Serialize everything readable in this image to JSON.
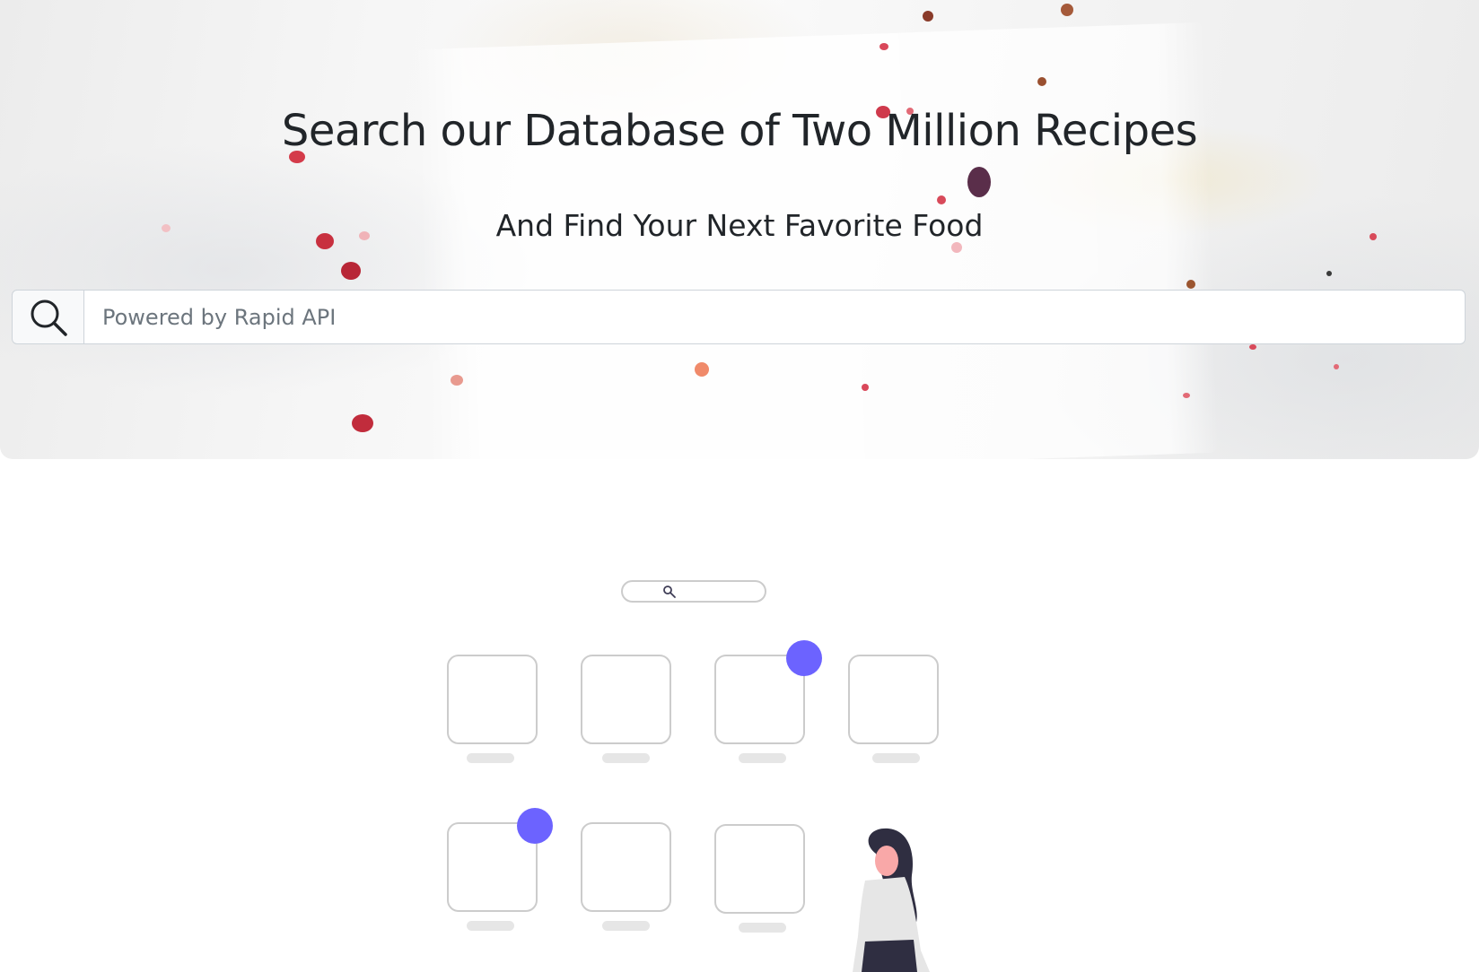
{
  "hero": {
    "title": "Search our Database of Two Million Recipes",
    "subtitle": "And Find Your Next Favorite Food"
  },
  "search": {
    "icon": "search-icon",
    "placeholder": "Powered by Rapid API",
    "value": ""
  },
  "illustration": {
    "description_icon": "empty-search-illustration",
    "accent_color": "#6c63ff",
    "tile_stroke": "#cccccc",
    "figure_hair": "#2f2e41",
    "figure_skin": "#f9a8a8",
    "figure_top": "#e6e6e6"
  },
  "colors": {
    "title_text": "#212529",
    "input_border": "#ced4da",
    "addon_bg": "#f8f9fa",
    "placeholder": "#6c757d"
  }
}
